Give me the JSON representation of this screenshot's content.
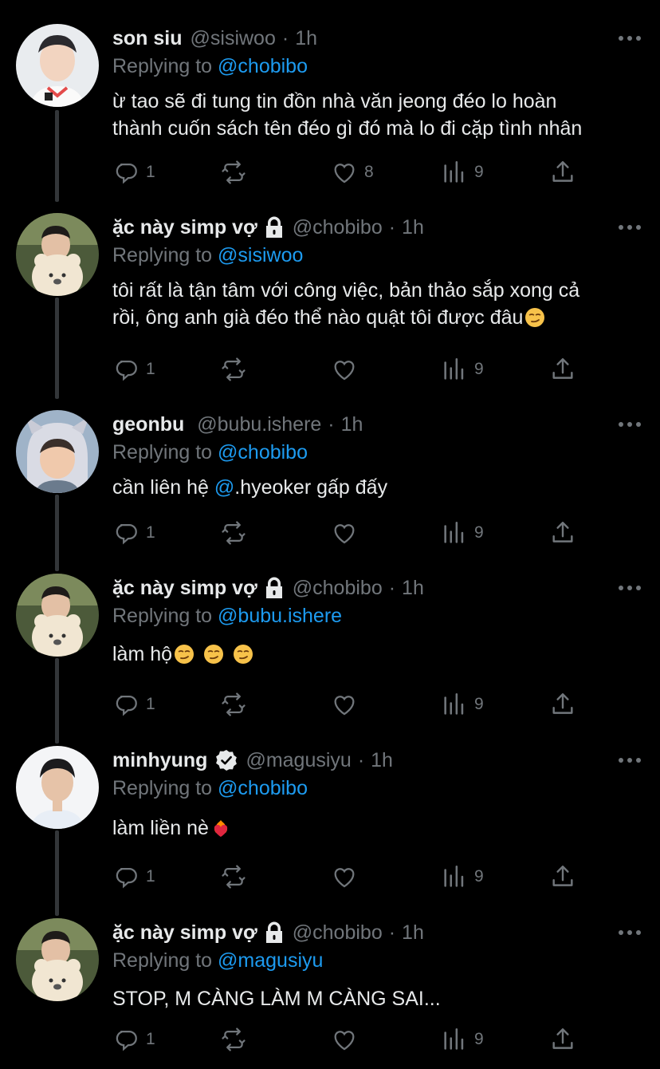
{
  "colors": {
    "background": "#000000",
    "text": "#e7e9ea",
    "muted": "#71767b",
    "accent": "#1d9bf0",
    "thread_line": "#333639"
  },
  "tweets": [
    {
      "name": "son siu",
      "handle": "@sisiwoo",
      "dot": "·",
      "time": "1h",
      "replying_prefix": "Replying to",
      "replying_to": "@chobibo",
      "text_lines": [
        "ừ tao sẽ đi tung tin đồn nhà văn jeong đéo lo hoàn",
        "thành cuốn sách tên đéo gì đó mà lo đi cặp tình nhân"
      ],
      "reply_count": "1",
      "like_count": "8",
      "view_count": "9",
      "badge": "none",
      "avatar": "avatar-sisiwoo"
    },
    {
      "name": "ặc này simp vợ",
      "handle": "@chobibo",
      "dot": "·",
      "time": "1h",
      "replying_prefix": "Replying to",
      "replying_to": "@sisiwoo",
      "text_lines": [
        "tôi rất là tận tâm với công việc, bản thảo sắp xong cả",
        "rồi, ông anh già đéo thể nào quật tôi được đâu"
      ],
      "emoji_after": [
        "smirk-emoji"
      ],
      "reply_count": "1",
      "like_count": "",
      "view_count": "9",
      "badge": "lock-icon",
      "avatar": "avatar-chobibo"
    },
    {
      "name": "geonbu",
      "handle": "@bubu.ishere",
      "dot": "·",
      "time": "1h",
      "replying_prefix": "Replying to",
      "replying_to": "@chobibo",
      "text_prefix": "cần liên hệ ",
      "text_mention": "@",
      "text_suffix": ".hyeoker gấp đấy",
      "reply_count": "1",
      "like_count": "",
      "view_count": "9",
      "badge": "none",
      "avatar": "avatar-bubu"
    },
    {
      "name": "ặc này simp vợ",
      "handle": "@chobibo",
      "dot": "·",
      "time": "1h",
      "replying_prefix": "Replying to",
      "replying_to": "@bubu.ishere",
      "text": "làm hộ",
      "emoji_after": [
        "smirk-emoji",
        "smirk-emoji",
        "smirk-emoji"
      ],
      "reply_count": "1",
      "like_count": "",
      "view_count": "9",
      "badge": "lock-icon",
      "avatar": "avatar-chobibo"
    },
    {
      "name": "minhyung",
      "handle": "@magusiyu",
      "dot": "·",
      "time": "1h",
      "replying_prefix": "Replying to",
      "replying_to": "@chobibo",
      "text": "làm liền nè",
      "emoji_after": [
        "heart-on-fire-emoji"
      ],
      "reply_count": "1",
      "like_count": "",
      "view_count": "9",
      "badge": "verified-icon",
      "avatar": "avatar-magusiyu"
    },
    {
      "name": "ặc này simp vợ",
      "handle": "@chobibo",
      "dot": "·",
      "time": "1h",
      "replying_prefix": "Replying to",
      "replying_to": "@magusiyu",
      "text": "STOP, M CÀNG LÀM M CÀNG SAI...",
      "reply_count": "1",
      "like_count": "",
      "view_count": "9",
      "badge": "lock-icon",
      "avatar": "avatar-chobibo"
    }
  ]
}
